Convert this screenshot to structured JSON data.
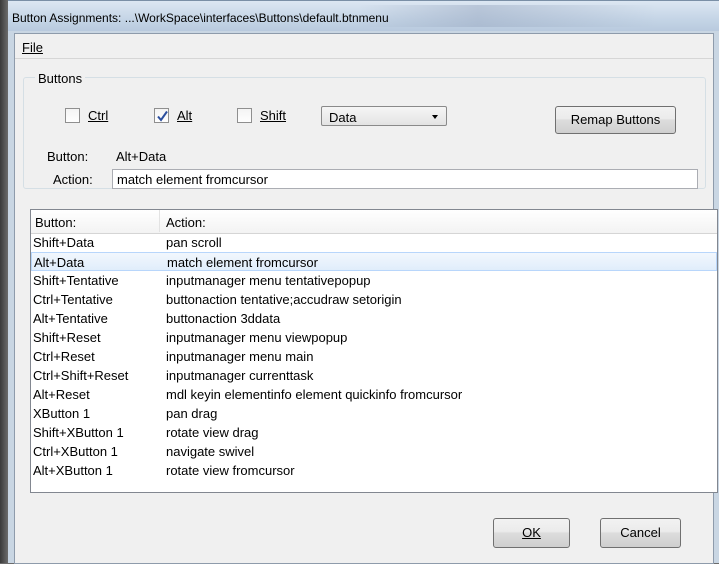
{
  "window": {
    "title": "Button Assignments: ...\\WorkSpace\\interfaces\\Buttons\\default.btnmenu"
  },
  "menu": {
    "file": "File"
  },
  "buttons_group": {
    "label": "Buttons",
    "ctrl": {
      "label": "Ctrl",
      "checked": false
    },
    "alt": {
      "label": "Alt",
      "checked": true
    },
    "shift": {
      "label": "Shift",
      "checked": false
    },
    "mouse_button": {
      "selected": "Data"
    },
    "remap_label": "Remap Buttons",
    "button_label": "Button:",
    "button_value": "Alt+Data",
    "action_label": "Action:",
    "action_value": "match element fromcursor"
  },
  "list": {
    "columns": [
      "Button:",
      "Action:"
    ],
    "rows": [
      {
        "button": "Shift+Data",
        "action": "pan scroll"
      },
      {
        "button": "Alt+Data",
        "action": "match element fromcursor",
        "selected": true
      },
      {
        "button": "Shift+Tentative",
        "action": "inputmanager menu tentativepopup"
      },
      {
        "button": "Ctrl+Tentative",
        "action": "buttonaction tentative;accudraw setorigin"
      },
      {
        "button": "Alt+Tentative",
        "action": "buttonaction 3ddata"
      },
      {
        "button": "Shift+Reset",
        "action": "inputmanager menu viewpopup"
      },
      {
        "button": "Ctrl+Reset",
        "action": "inputmanager menu main"
      },
      {
        "button": "Ctrl+Shift+Reset",
        "action": "inputmanager currenttask"
      },
      {
        "button": "Alt+Reset",
        "action": "mdl keyin elementinfo element quickinfo fromcursor"
      },
      {
        "button": "XButton 1",
        "action": "pan drag"
      },
      {
        "button": "Shift+XButton 1",
        "action": "rotate view drag"
      },
      {
        "button": "Ctrl+XButton 1",
        "action": "navigate swivel"
      },
      {
        "button": "Alt+XButton 1",
        "action": "rotate view fromcursor"
      }
    ]
  },
  "footer": {
    "ok": "OK",
    "cancel": "Cancel"
  },
  "icons": {
    "checkmark": "checkmark-icon",
    "dropdown": "dropdown-arrow-icon"
  }
}
